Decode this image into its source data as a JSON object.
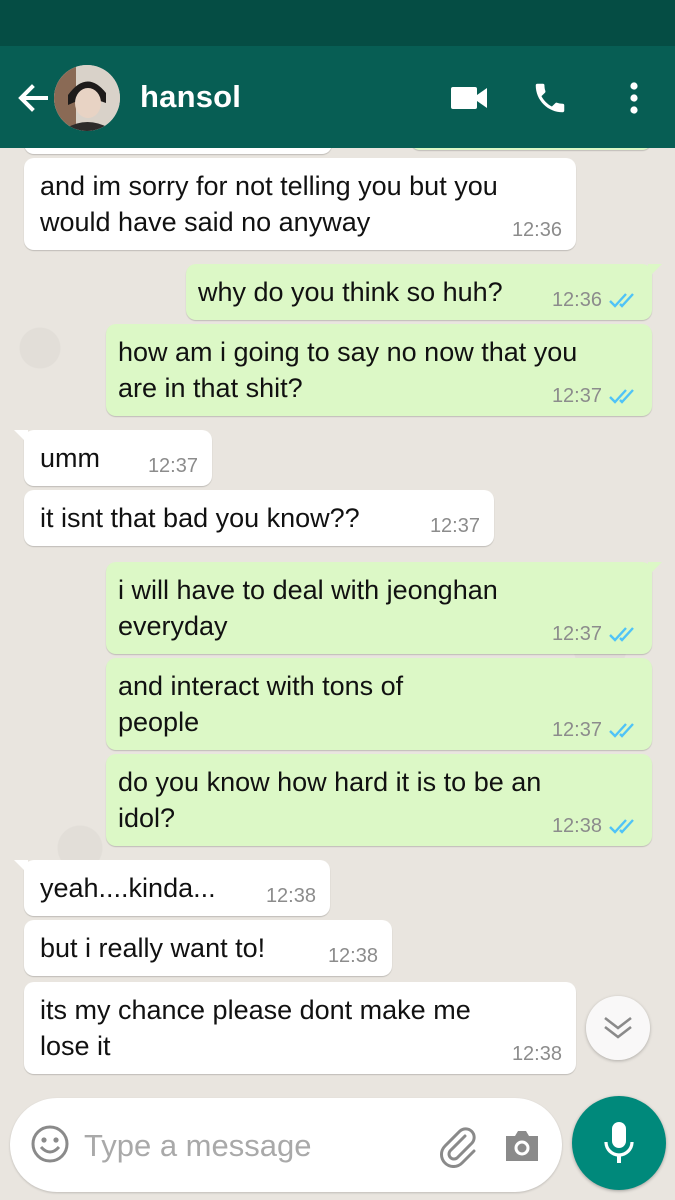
{
  "header": {
    "contact_name": "hansol",
    "icons": [
      "back-arrow-icon",
      "video-call-icon",
      "voice-call-icon",
      "more-options-icon"
    ]
  },
  "messages": [
    {
      "direction": "in",
      "text": "and im sorry for not telling you but you\nwould have said no anyway",
      "time": "12:36"
    },
    {
      "direction": "out",
      "text": "why do you think so huh?",
      "time": "12:36",
      "read": true
    },
    {
      "direction": "out",
      "text": "how am i going to say no now that you\nare in that shit?",
      "time": "12:37",
      "read": true
    },
    {
      "direction": "in",
      "text": "umm",
      "time": "12:37"
    },
    {
      "direction": "in",
      "text": "it isnt that bad you know??",
      "time": "12:37"
    },
    {
      "direction": "out",
      "text": "i will have to deal with jeonghan\neveryday",
      "time": "12:37",
      "read": true
    },
    {
      "direction": "out",
      "text": "and interact with tons of\npeople",
      "time": "12:37",
      "read": true
    },
    {
      "direction": "out",
      "text": "do you know how hard it is to be an\nidol?",
      "time": "12:38",
      "read": true
    },
    {
      "direction": "in",
      "text": "yeah....kinda...",
      "time": "12:38"
    },
    {
      "direction": "in",
      "text": "but i really want to!",
      "time": "12:38"
    },
    {
      "direction": "in",
      "text": "its my chance please dont make me\nlose it",
      "time": "12:38"
    }
  ],
  "composer": {
    "placeholder": "Type a message",
    "value": ""
  },
  "colors": {
    "header": "#075e54",
    "statusbar": "#054d44",
    "outgoing_bubble": "#dcf8c6",
    "incoming_bubble": "#ffffff",
    "read_ticks": "#4fc3f7",
    "mic_button": "#00897b"
  }
}
